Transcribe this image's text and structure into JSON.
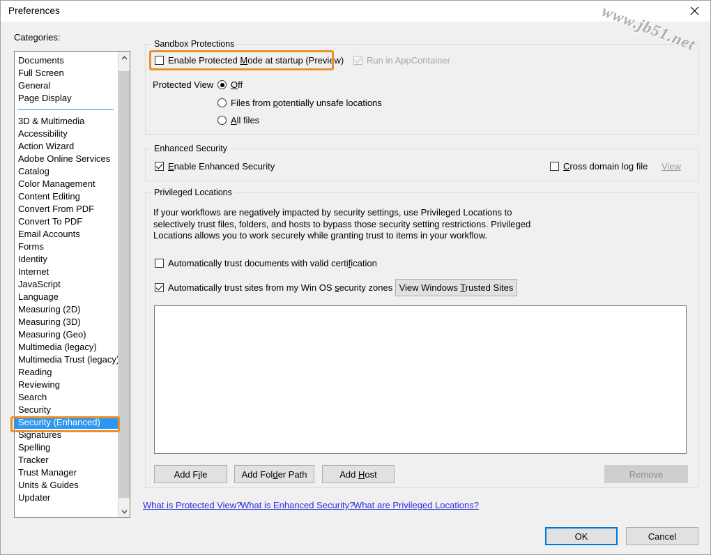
{
  "window": {
    "title": "Preferences",
    "close_icon": "close-icon",
    "watermark": "www.jb51.net"
  },
  "sidebar": {
    "label": "Categories:",
    "scroll_up_icon": "chevron-up-icon",
    "scroll_down_icon": "chevron-down-icon",
    "group1": [
      {
        "label": "Documents"
      },
      {
        "label": "Full Screen"
      },
      {
        "label": "General"
      },
      {
        "label": "Page Display"
      }
    ],
    "group2": [
      {
        "label": "3D & Multimedia"
      },
      {
        "label": "Accessibility"
      },
      {
        "label": "Action Wizard"
      },
      {
        "label": "Adobe Online Services"
      },
      {
        "label": "Catalog"
      },
      {
        "label": "Color Management"
      },
      {
        "label": "Content Editing"
      },
      {
        "label": "Convert From PDF"
      },
      {
        "label": "Convert To PDF"
      },
      {
        "label": "Email Accounts"
      },
      {
        "label": "Forms"
      },
      {
        "label": "Identity"
      },
      {
        "label": "Internet"
      },
      {
        "label": "JavaScript"
      },
      {
        "label": "Language"
      },
      {
        "label": "Measuring (2D)"
      },
      {
        "label": "Measuring (3D)"
      },
      {
        "label": "Measuring (Geo)"
      },
      {
        "label": "Multimedia (legacy)"
      },
      {
        "label": "Multimedia Trust (legacy)"
      },
      {
        "label": "Reading"
      },
      {
        "label": "Reviewing"
      },
      {
        "label": "Search"
      },
      {
        "label": "Security"
      },
      {
        "label": "Security (Enhanced)",
        "selected": true
      },
      {
        "label": "Signatures"
      },
      {
        "label": "Spelling"
      },
      {
        "label": "Tracker"
      },
      {
        "label": "Trust Manager"
      },
      {
        "label": "Units & Guides"
      },
      {
        "label": "Updater"
      }
    ]
  },
  "sandbox": {
    "title": "Sandbox Protections",
    "protected_mode": {
      "label": "Enable Protected Mode at startup (Preview)",
      "checked": false,
      "highlighted": true
    },
    "appcontainer": {
      "label": "Run in AppContainer",
      "checked": true,
      "disabled": true
    },
    "protected_view_label": "Protected View",
    "protected_view_options": [
      {
        "label": "Off",
        "selected": true
      },
      {
        "label": "Files from potentially unsafe locations",
        "selected": false
      },
      {
        "label": "All files",
        "selected": false
      }
    ]
  },
  "enhanced_security": {
    "title": "Enhanced Security",
    "enable": {
      "label": "Enable Enhanced Security",
      "checked": true
    },
    "cross_domain": {
      "label": "Cross domain log file",
      "checked": false
    },
    "view_link": "View"
  },
  "privileged_locations": {
    "title": "Privileged Locations",
    "description": "If your workflows are negatively impacted by security settings, use Privileged Locations to selectively trust files, folders, and hosts to bypass those security setting restrictions. Privileged Locations allows you to work securely while granting trust to items in your workflow.",
    "trust_certified": {
      "label": "Automatically trust documents with valid certification",
      "checked": false
    },
    "trust_zones": {
      "label": "Automatically trust sites from my Win OS security zones",
      "checked": true
    },
    "view_trusted_sites_button": "View Windows Trusted Sites",
    "list_items": [],
    "add_file_button": "Add File",
    "add_folder_button": "Add Folder Path",
    "add_host_button": "Add Host",
    "remove_button": "Remove"
  },
  "help_links": [
    {
      "label": "What is Protected View?"
    },
    {
      "label": "What is Enhanced Security?"
    },
    {
      "label": "What are Privileged Locations?"
    }
  ],
  "footer": {
    "ok_button": "OK",
    "cancel_button": "Cancel"
  },
  "colors": {
    "highlight_orange": "#e8912a",
    "selection_blue": "#2b97f3",
    "focus_blue": "#0078d7",
    "link_blue": "#2b2be0",
    "dialog_bg": "#f0f0f0"
  }
}
